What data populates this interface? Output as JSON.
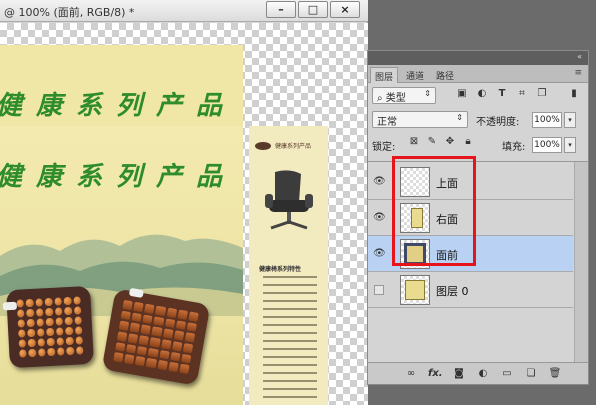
{
  "document": {
    "title": "@ 100% (面前, RGB/8) *",
    "buttons": {
      "minimize": "–",
      "restore": "□",
      "close": "×"
    }
  },
  "artwork": {
    "top_panel_title": "健康系列产品",
    "front_panel_title": "健康系列产品",
    "side_brand": "健康系列产品",
    "side_heading": "健康椅系列特性"
  },
  "layers_panel": {
    "panel_menu": "«",
    "tabs": [
      {
        "label": "图层",
        "active": true
      },
      {
        "label": "通道",
        "active": false
      },
      {
        "label": "路径",
        "active": false
      }
    ],
    "tab_menu_icon": "≡",
    "filter": {
      "label": "类型",
      "icons": [
        "image-filter-icon",
        "adjustment-filter-icon",
        "type-filter-icon",
        "shape-filter-icon",
        "smart-object-filter-icon"
      ]
    },
    "blend_mode": "正常",
    "opacity_label": "不透明度:",
    "opacity_value": "100%",
    "lock_label": "锁定:",
    "fill_label": "填充:",
    "fill_value": "100%",
    "layers": [
      {
        "name": "上面",
        "visible": true,
        "selected": false,
        "thumb": "transparent"
      },
      {
        "name": "右面",
        "visible": true,
        "selected": false,
        "thumb": "side-art"
      },
      {
        "name": "面前",
        "visible": true,
        "selected": true,
        "thumb": "front-art"
      },
      {
        "name": "图层 0",
        "visible": false,
        "selected": false,
        "thumb": "side-art"
      }
    ],
    "bottom_icons": [
      "link-icon",
      "fx-icon",
      "mask-icon",
      "adjustment-icon",
      "folder-icon",
      "new-layer-icon",
      "trash-icon"
    ],
    "bottom_fx_label": "fx."
  },
  "annotation_color": "#e8141b"
}
